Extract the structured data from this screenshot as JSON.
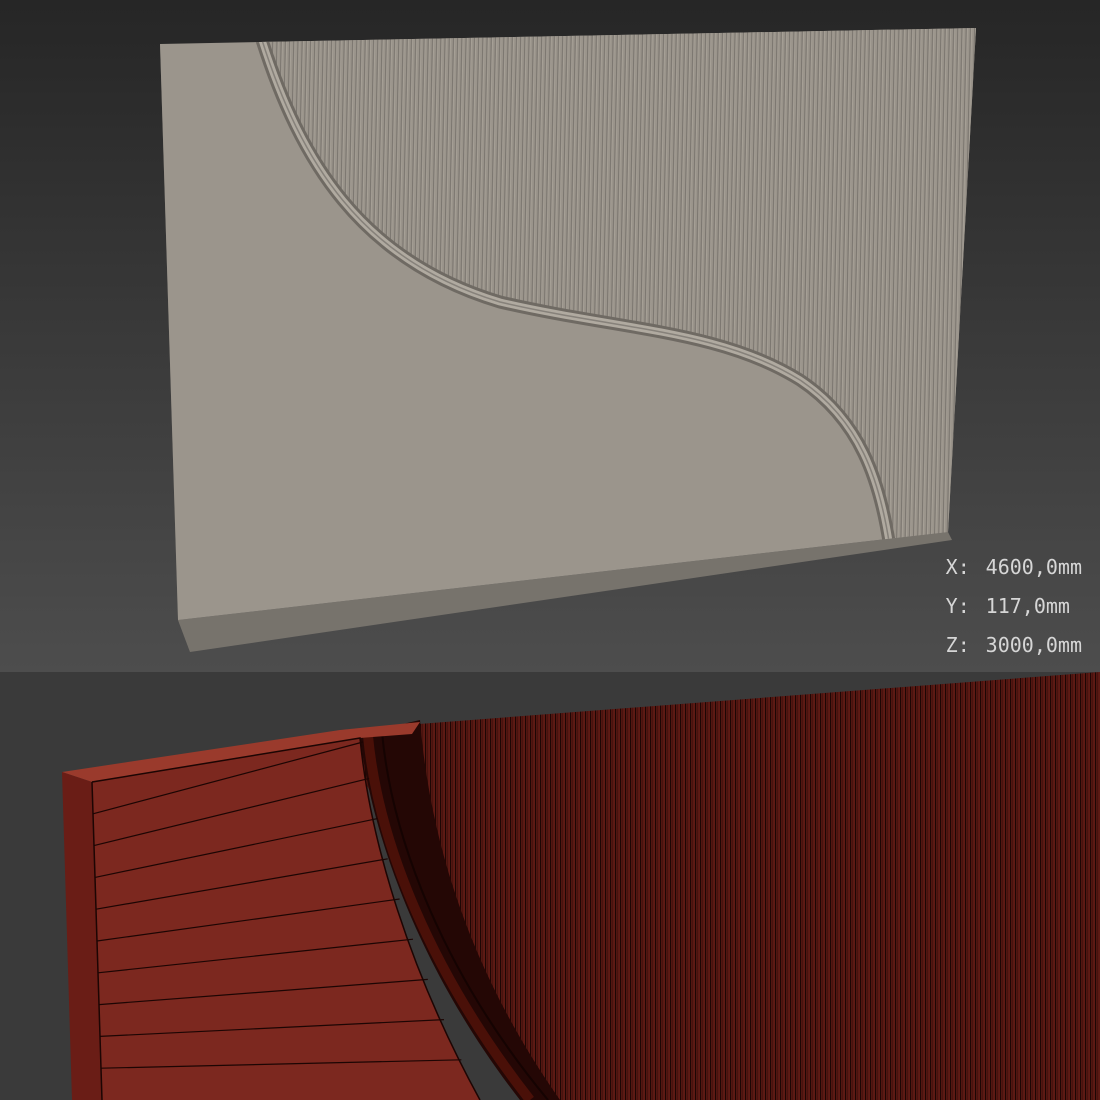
{
  "viewports": {
    "top": {
      "background_top": "#2a2a2a",
      "background_bottom": "#4c4c4c",
      "panel_color": "#9b958c",
      "panel_edge_color": "#6e6a64",
      "dimensions": [
        {
          "axis": "X:",
          "value": "4600,0mm"
        },
        {
          "axis": "Y:",
          "value": "117,0mm"
        },
        {
          "axis": "Z:",
          "value": "3000,0mm"
        }
      ]
    },
    "bottom": {
      "mesh_color": "#7a2820",
      "mesh_dark": "#3a0c08",
      "wire_color": "#1c0503",
      "background": "#3b3b3b"
    }
  }
}
